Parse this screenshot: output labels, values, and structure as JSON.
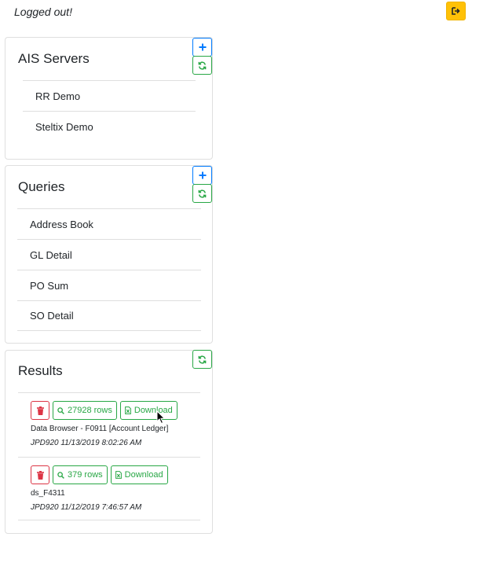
{
  "header": {
    "status_text": "Logged out!",
    "logout_icon": "sign-out-icon",
    "logout_color": "#ffc107"
  },
  "servers": {
    "title": "AIS Servers",
    "add_icon": "plus-icon",
    "refresh_icon": "refresh-icon",
    "items": [
      {
        "label": "RR Demo"
      },
      {
        "label": "Steltix Demo"
      }
    ]
  },
  "queries": {
    "title": "Queries",
    "add_icon": "plus-icon",
    "refresh_icon": "refresh-icon",
    "items": [
      {
        "label": "Address Book"
      },
      {
        "label": "GL Detail"
      },
      {
        "label": "PO Sum"
      },
      {
        "label": "SO Detail"
      }
    ]
  },
  "results": {
    "title": "Results",
    "refresh_icon": "refresh-icon",
    "items": [
      {
        "rows_label": "27928 rows",
        "download_label": "Download",
        "name": "Data Browser - F0911 [Account Ledger]",
        "meta": "JPD920 11/13/2019 8:02:26 AM"
      },
      {
        "rows_label": "379 rows",
        "download_label": "Download",
        "name": "ds_F4311",
        "meta": "JPD920 11/12/2019 7:46:57 AM"
      }
    ]
  },
  "colors": {
    "primary": "#007bff",
    "success": "#28a745",
    "danger": "#dc3545",
    "warning": "#ffc107"
  }
}
